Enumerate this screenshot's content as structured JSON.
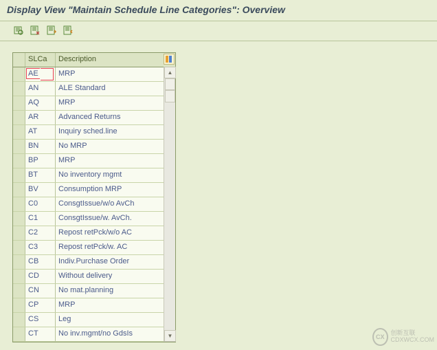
{
  "title": "Display View \"Maintain Schedule Line Categories\": Overview",
  "columns": {
    "slca": "SLCa",
    "description": "Description"
  },
  "rows": [
    {
      "slca": "AE",
      "desc": "MRP",
      "highlight": true
    },
    {
      "slca": "AN",
      "desc": "ALE Standard"
    },
    {
      "slca": "AQ",
      "desc": "MRP"
    },
    {
      "slca": "AR",
      "desc": "Advanced Returns"
    },
    {
      "slca": "AT",
      "desc": "Inquiry sched.line"
    },
    {
      "slca": "BN",
      "desc": "No MRP"
    },
    {
      "slca": "BP",
      "desc": "MRP"
    },
    {
      "slca": "BT",
      "desc": "No inventory mgmt"
    },
    {
      "slca": "BV",
      "desc": "Consumption MRP"
    },
    {
      "slca": "C0",
      "desc": "ConsgtIssue/w/o AvCh"
    },
    {
      "slca": "C1",
      "desc": "ConsgtIssue/w. AvCh."
    },
    {
      "slca": "C2",
      "desc": "Repost retPck/w/o AC"
    },
    {
      "slca": "C3",
      "desc": "Repost retPck/w. AC"
    },
    {
      "slca": "CB",
      "desc": "Indiv.Purchase Order"
    },
    {
      "slca": "CD",
      "desc": "Without delivery"
    },
    {
      "slca": "CN",
      "desc": "No mat.planning"
    },
    {
      "slca": "CP",
      "desc": "MRP"
    },
    {
      "slca": "CS",
      "desc": "Leg"
    },
    {
      "slca": "CT",
      "desc": "No inv.mgmt/no GdsIs"
    }
  ],
  "watermark": {
    "logo": "CX",
    "line1": "创新互联",
    "line2": "CDXWCX.COM"
  }
}
